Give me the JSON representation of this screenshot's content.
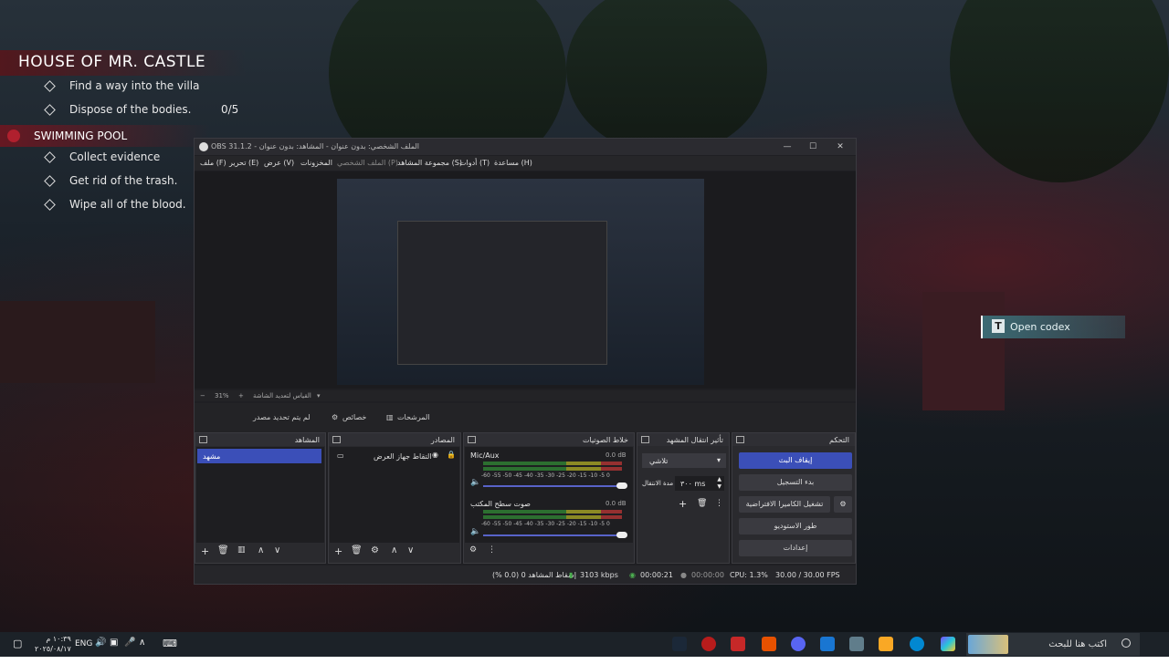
{
  "game": {
    "mission_title": "HOUSE OF MR. CASTLE",
    "objectives": [
      {
        "text": "Find a way into the villa",
        "count": ""
      },
      {
        "text": "Dispose of the bodies.",
        "count": "0/5"
      }
    ],
    "subsection_title": "SWIMMING POOL",
    "sub_objectives": [
      {
        "text": "Collect evidence"
      },
      {
        "text": "Get rid of the trash."
      },
      {
        "text": "Wipe all of the blood."
      }
    ],
    "codex_prompt": {
      "key": "T",
      "label": "Open codex"
    }
  },
  "obs": {
    "window_title": "OBS 31.1.2 - الملف الشخصي: بدون عنوان - المشاهد: بدون عنوان",
    "menu": [
      "ملف (F)",
      "تحرير (E)",
      "عرض (V)",
      "المخزونات",
      "الملف الشخصي (P)",
      "مجموعة المشاهد (S)",
      "أدوات (T)",
      "مساعدة (H)"
    ],
    "zoom": "31%",
    "zoom_mode": "القياس لتعديد الشاشة",
    "no_source": "لم يتم تحديد مصدر",
    "properties_btn": "خصائص",
    "filters_btn": "المرشحات",
    "scenes": {
      "title": "المشاهد",
      "items": [
        "مشهد"
      ]
    },
    "sources": {
      "title": "المصادر",
      "items": [
        "التقاط جهاز العرض"
      ]
    },
    "mixer": {
      "title": "خلاط الصوتيات",
      "channels": [
        {
          "name": "Mic/Aux",
          "db": "0.0 dB"
        },
        {
          "name": "صوت سطح المكتب",
          "db": "0.0 dB"
        }
      ],
      "ticks": [
        "-60",
        "-55",
        "-50",
        "-45",
        "-40",
        "-35",
        "-30",
        "-25",
        "-20",
        "-15",
        "-10",
        "-5",
        "0"
      ]
    },
    "transitions": {
      "title": "تأثير انتقال المشهد",
      "selected": "تلاشي",
      "duration_label": "مدة الانتقال",
      "duration": "٣٠٠ ms"
    },
    "controls": {
      "title": "التحكم",
      "buttons": [
        "إيقاف البث",
        "بدء التسجيل",
        "تشغيل الكاميرا الافتراضية",
        "طور الاستوديو",
        "إعدادات"
      ]
    },
    "status": {
      "dropped": "إسقاط المشاهد 0 (0.0 %)",
      "bitrate": "3103 kbps",
      "stream_time": "00:00:21",
      "rec_time": "00:00:00",
      "cpu": "CPU: 1.3%",
      "fps": "30.00 / 30.00 FPS"
    }
  },
  "taskbar": {
    "search_placeholder": "اكتب هنا للبحث",
    "lang": "ENG",
    "time": "١٠:٣٩ م",
    "date": "٢٠٢٥/٠٨/١٧"
  }
}
